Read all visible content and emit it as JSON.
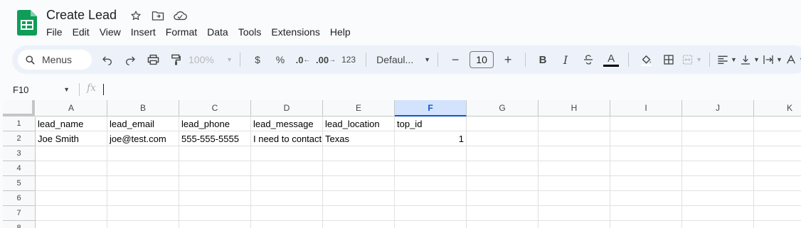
{
  "title_bar": {
    "doc_title": "Create Lead",
    "icons": [
      "star-icon",
      "move-to-folder-icon",
      "cloud-saved-icon"
    ]
  },
  "menu": [
    "File",
    "Edit",
    "View",
    "Insert",
    "Format",
    "Data",
    "Tools",
    "Extensions",
    "Help"
  ],
  "toolbar": {
    "search_label": "Menus",
    "zoom": "100%",
    "currency_symbol": "$",
    "percent_symbol": "%",
    "decrease_decimal": ".0",
    "increase_decimal": ".00",
    "number_format": "123",
    "font": "Defaul...",
    "font_size": "10",
    "minus": "−",
    "plus": "+",
    "bold": "B",
    "italic": "I",
    "text_color_letter": "A"
  },
  "formula_bar": {
    "name_box": "F10",
    "fx": "fx",
    "value": ""
  },
  "grid": {
    "columns": [
      "A",
      "B",
      "C",
      "D",
      "E",
      "F",
      "G",
      "H",
      "I",
      "J",
      "K"
    ],
    "selected_column": "F",
    "rows": [
      "1",
      "2",
      "3",
      "4",
      "5",
      "6",
      "7",
      "8"
    ],
    "cells": [
      [
        "lead_name",
        "lead_email",
        "lead_phone",
        "lead_message",
        "lead_location",
        "top_id",
        "",
        "",
        "",
        "",
        ""
      ],
      [
        "Joe Smith",
        "joe@test.com",
        "555-555-5555",
        "I need to contact",
        "Texas",
        "1",
        "",
        "",
        "",
        "",
        ""
      ]
    ]
  },
  "colors": {
    "accent": "#0b57d0",
    "sheets_green": "#0f9d58",
    "toolbar_bg": "#edf2fa",
    "selected_header": "#d3e3fd"
  }
}
